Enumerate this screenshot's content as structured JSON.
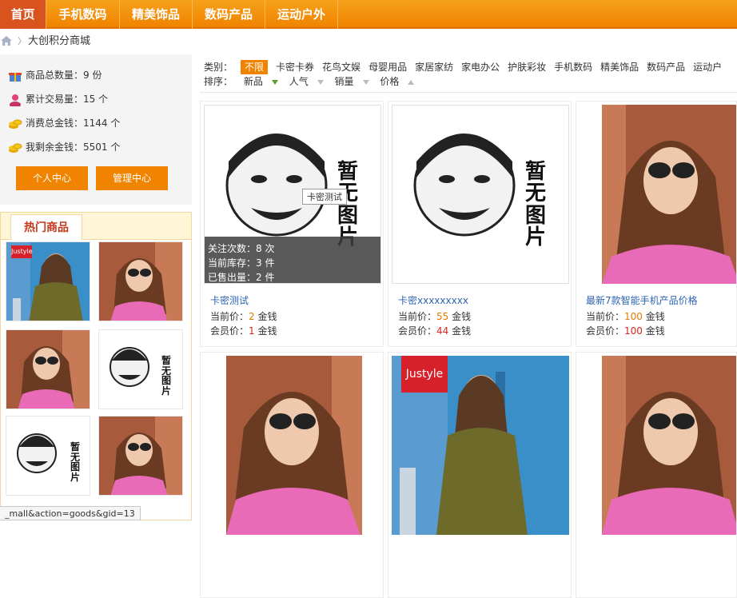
{
  "nav": {
    "items": [
      "首页",
      "手机数码",
      "精美饰品",
      "数码产品",
      "运动户外"
    ],
    "active": 0
  },
  "breadcrumb": {
    "text": "大创积分商城"
  },
  "stats": {
    "total_goods": "商品总数量：9 份",
    "total_trades": "累计交易量：15 个",
    "total_spent": "消费总金钱：1144 个",
    "my_balance": "我剩余金钱：5501 个"
  },
  "buttons": {
    "personal": "个人中心",
    "admin": "管理中心"
  },
  "hot": {
    "title": "热门商品"
  },
  "filters": {
    "category_label": "类别：",
    "categories": [
      "不限",
      "卡密卡券",
      "花鸟文娱",
      "母婴用品",
      "家居家纺",
      "家电办公",
      "护肤彩妆",
      "手机数码",
      "精美饰品",
      "数码产品",
      "运动户"
    ],
    "sort_label": "排序：",
    "sorts": [
      "新品",
      "人气",
      "销量",
      "价格"
    ]
  },
  "no_image_text": "暂无图片",
  "brand_logo": "Justyle",
  "products": [
    {
      "title": "卡密测试",
      "price_label": "当前价：",
      "price": "2",
      "member_label": "会员价：",
      "member_price": "1",
      "unit": "金钱",
      "overlay": [
        "关注次数：8 次",
        "当前库存：3 件",
        "已售出量：2 件"
      ]
    },
    {
      "title": "卡密xxxxxxxxx",
      "price_label": "当前价：",
      "price": "55",
      "member_label": "会员价：",
      "member_price": "44",
      "unit": "金钱"
    },
    {
      "title": "最新7款智能手机产品价格",
      "price_label": "当前价：",
      "price": "100",
      "member_label": "会员价：",
      "member_price": "100",
      "unit": "金钱"
    }
  ],
  "tooltip": "卡密测试",
  "status_url": "_mall&action=goods&gid=13"
}
